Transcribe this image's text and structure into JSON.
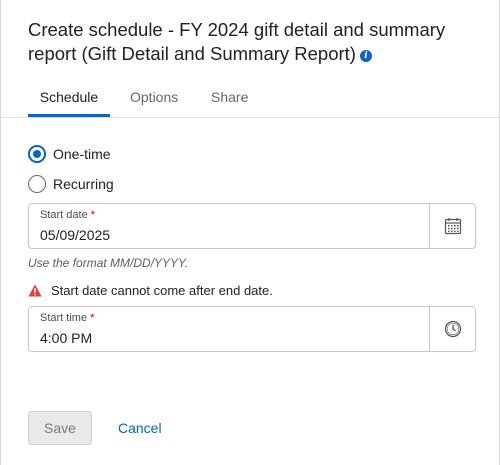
{
  "dialog": {
    "title": "Create schedule - FY 2024 gift detail and summary report (Gift Detail and Summary Report)",
    "info_icon": "info-icon"
  },
  "tabs": [
    {
      "label": "Schedule",
      "active": true
    },
    {
      "label": "Options",
      "active": false
    },
    {
      "label": "Share",
      "active": false
    }
  ],
  "frequency": {
    "options": [
      {
        "label": "One-time",
        "selected": true
      },
      {
        "label": "Recurring",
        "selected": false
      }
    ]
  },
  "start_date": {
    "label": "Start date",
    "required_mark": "*",
    "value": "05/09/2025",
    "icon": "calendar-icon",
    "hint": "Use the format MM/DD/YYYY."
  },
  "error": {
    "icon": "warning-icon",
    "message": "Start date cannot come after end date.",
    "color": "#e0403a"
  },
  "start_time": {
    "label": "Start time",
    "required_mark": "*",
    "value": "4:00 PM",
    "icon": "clock-icon"
  },
  "footer": {
    "save_label": "Save",
    "cancel_label": "Cancel"
  },
  "colors": {
    "accent": "#0b63c4",
    "required": "#d10000"
  }
}
